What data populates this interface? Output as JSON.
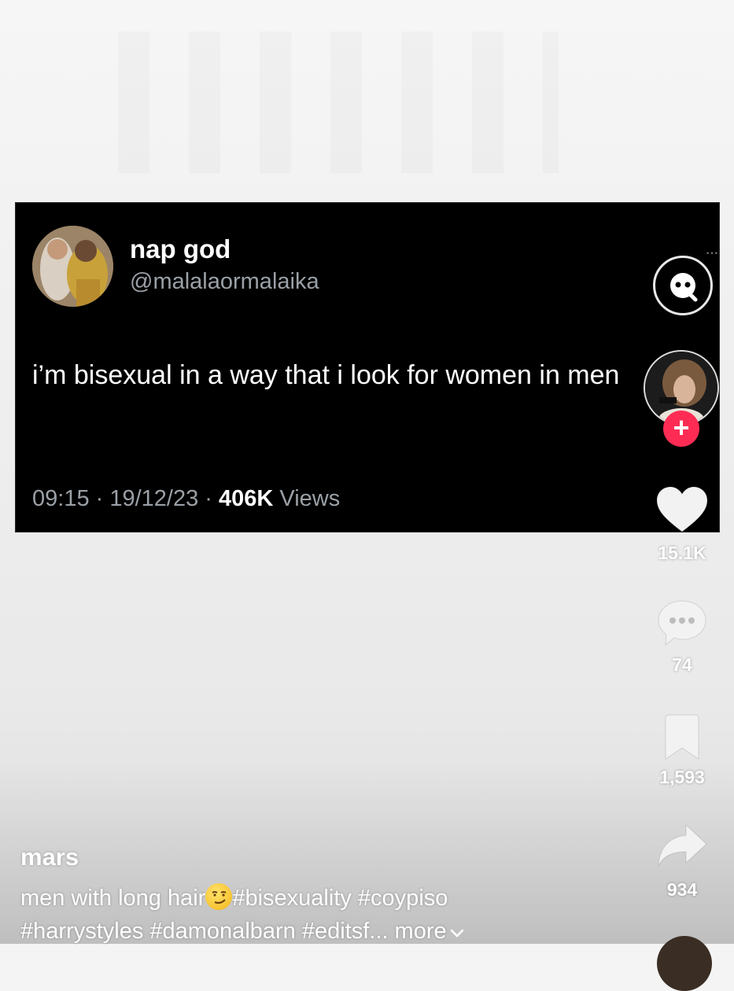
{
  "tweet": {
    "name": "nap god",
    "handle": "@malalaormalaika",
    "more": "···",
    "text": "i’m bisexual in a way that i look for women in men",
    "time_date": "09:15 · 19/12/23 · ",
    "views_count": "406K",
    "views_label": " Views"
  },
  "rail": {
    "search_icon": "search-face-icon",
    "follow_icon": "plus-icon",
    "likes": "15.1K",
    "comments": "74",
    "saves": "1,593",
    "shares": "934"
  },
  "caption": {
    "username": "mars",
    "text_before_emoji": "men with long hair",
    "emoji": "smirking-face",
    "hashtags_line1": "#bisexuality #coypiso",
    "hashtags_line2": "#harrystyles #damonalbarn #editsf...",
    "more": "more"
  },
  "colors": {
    "follow_accent": "#fe2c55",
    "tweet_bg": "#000000",
    "tweet_secondary": "#9aa0a6"
  }
}
